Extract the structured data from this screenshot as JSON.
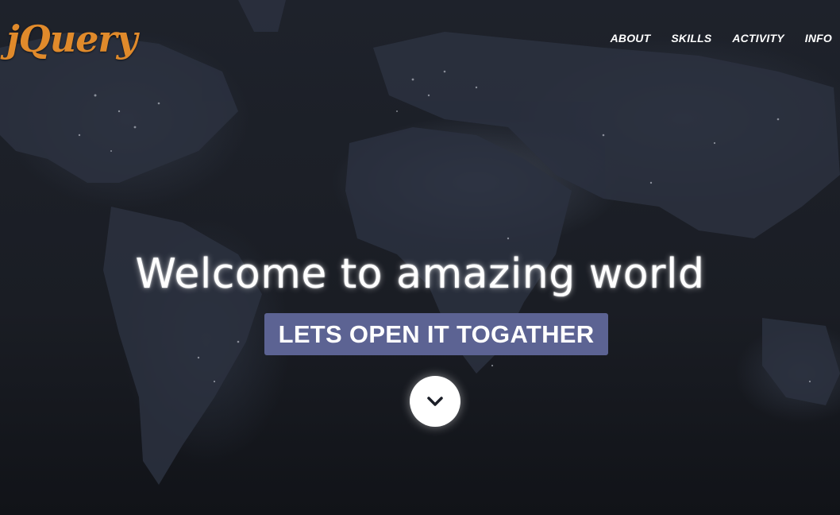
{
  "header": {
    "logo_text": "jQuery",
    "nav": [
      {
        "label": "ABOUT"
      },
      {
        "label": "SKILLS"
      },
      {
        "label": "ACTIVITY"
      },
      {
        "label": "INFO"
      }
    ]
  },
  "hero": {
    "title": "Welcome to amazing world",
    "subtitle": "LETS OPEN IT TOGATHER",
    "scroll_icon": "chevron-down-icon"
  },
  "colors": {
    "logo": "#e08a2b",
    "subtitle_bg": "#5c6393",
    "background": "#1a1d24"
  }
}
